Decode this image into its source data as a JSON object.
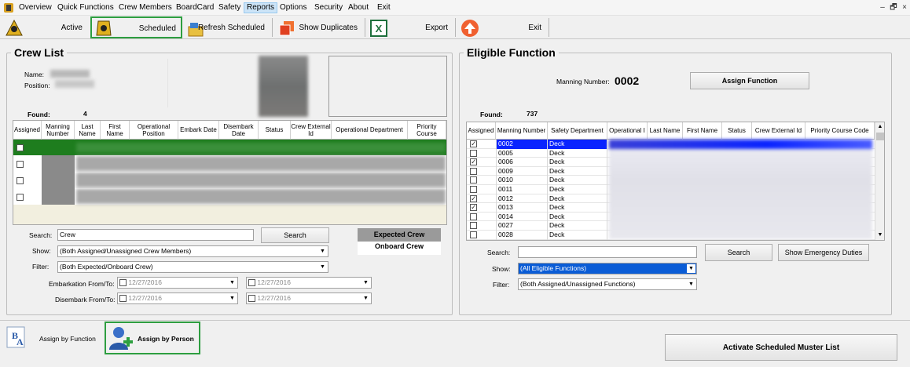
{
  "menu": [
    "Overview",
    "Quick Functions",
    "Crew Members",
    "BoardCard",
    "Safety",
    "Reports",
    "Options",
    "Security",
    "About",
    "Exit"
  ],
  "window_controls": [
    "–",
    "🗗",
    "×"
  ],
  "toolbar": {
    "active": "Active",
    "scheduled": "Scheduled",
    "refresh": "Refresh Scheduled",
    "duplicates": "Show Duplicates",
    "export": "Export",
    "exit": "Exit"
  },
  "crew_list": {
    "title": "Crew List",
    "name_label": "Name:",
    "position_label": "Position:",
    "found_label": "Found:",
    "found_count": "4",
    "columns": [
      "Assigned",
      "Manning Number",
      "Last Name",
      "First Name",
      "Operational Position",
      "Embark Date",
      "Disembark Date",
      "Status",
      "Crew External Id",
      "Operational Department",
      "Priority Course"
    ],
    "rows": [
      {
        "assigned": false,
        "selected": true
      },
      {
        "assigned": false,
        "selected": false
      },
      {
        "assigned": false,
        "selected": false
      },
      {
        "assigned": false,
        "selected": false
      }
    ],
    "search_label": "Search:",
    "search_value": "Crew",
    "search_button": "Search",
    "show_label": "Show:",
    "show_value": "(Both Assigned/Unassigned Crew Members)",
    "filter_label": "Filter:",
    "filter_value": "(Both Expected/Onboard Crew)",
    "embark_label": "Embarkation From/To:",
    "disembark_label": "Disembark From/To:",
    "embark_from": "12/27/2016",
    "embark_to": "12/27/2016",
    "disembark_from": "12/27/2016",
    "disembark_to": "12/27/2016",
    "legend_expected": "Expected Crew",
    "legend_onboard": "Onboard Crew"
  },
  "eligible": {
    "title": "Eligible Function",
    "manning_label": "Manning Number:",
    "manning_value": "0002",
    "assign_button": "Assign Function",
    "found_label": "Found:",
    "found_count": "737",
    "columns": [
      "Assigned",
      "Manning Number",
      "Safety Department",
      "Operational I",
      "Last Name",
      "First Name",
      "Status",
      "Crew External Id",
      "Priority Course Code"
    ],
    "rows": [
      {
        "assigned": true,
        "manning": "0002",
        "dept": "Deck",
        "selected": true
      },
      {
        "assigned": false,
        "manning": "0005",
        "dept": "Deck",
        "selected": false
      },
      {
        "assigned": true,
        "manning": "0006",
        "dept": "Deck",
        "selected": false
      },
      {
        "assigned": false,
        "manning": "0009",
        "dept": "Deck",
        "selected": false
      },
      {
        "assigned": false,
        "manning": "0010",
        "dept": "Deck",
        "selected": false
      },
      {
        "assigned": false,
        "manning": "0011",
        "dept": "Deck",
        "selected": false
      },
      {
        "assigned": true,
        "manning": "0012",
        "dept": "Deck",
        "selected": false
      },
      {
        "assigned": true,
        "manning": "0013",
        "dept": "Deck",
        "selected": false
      },
      {
        "assigned": false,
        "manning": "0014",
        "dept": "Deck",
        "selected": false
      },
      {
        "assigned": false,
        "manning": "0027",
        "dept": "Deck",
        "selected": false
      },
      {
        "assigned": false,
        "manning": "0028",
        "dept": "Deck",
        "selected": false
      }
    ],
    "search_label": "Search:",
    "search_value": "",
    "search_button": "Search",
    "emergency_button": "Show Emergency Duties",
    "show_label": "Show:",
    "show_value": "(All Eligible Functions)",
    "filter_label": "Filter:",
    "filter_value": "(Both Assigned/Unassigned Functions)"
  },
  "bottom": {
    "assign_function": "Assign by Function",
    "assign_person": "Assign by Person",
    "activate": "Activate Scheduled Muster List"
  },
  "colors": {
    "selection_green": "#1e7d1e",
    "selection_blue": "#0a24ff",
    "highlight_border": "#2e9e40"
  }
}
